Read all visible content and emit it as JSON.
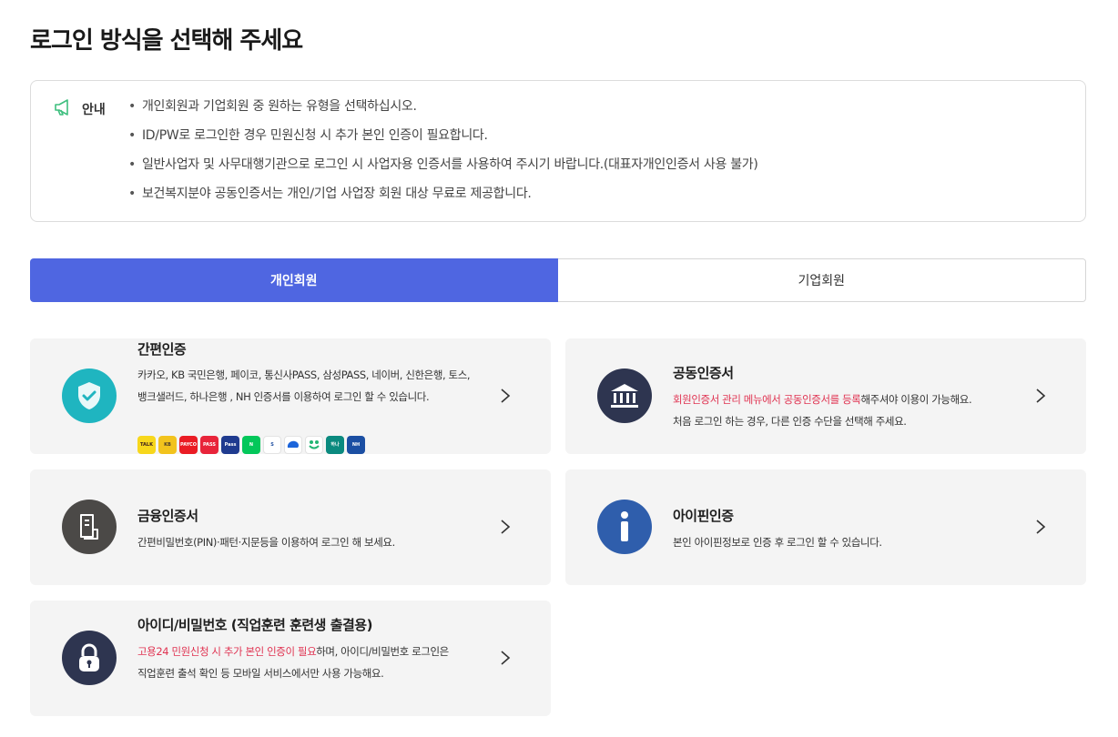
{
  "page": {
    "title": "로그인 방식을 선택해 주세요"
  },
  "notice": {
    "label": "안내",
    "items": [
      "개인회원과 기업회원 중 원하는 유형을 선택하십시오.",
      "ID/PW로 로그인한 경우 민원신청 시 추가 본인 인증이 필요합니다.",
      "일반사업자 및 사무대행기관으로 로그인 시 사업자용 인증서를 사용하여 주시기 바랍니다.(대표자개인인증서 사용 불가)",
      "보건복지분야 공동인증서는 개인/기업 사업장 회원 대상 무료로 제공합니다."
    ]
  },
  "tabs": [
    {
      "label": "개인회원",
      "active": true
    },
    {
      "label": "기업회원",
      "active": false
    }
  ],
  "methods": {
    "simple": {
      "title": "간편인증",
      "desc": "카카오, KB 국민은행, 페이코, 통신사PASS, 삼성PASS, 네이버, 신한은행, 토스, 뱅크샐러드, 하나은행 , NH 인증서를 이용하여 로그인 할 수 있습니다.",
      "brands": [
        {
          "icon": "kakao-icon",
          "text": "TALK",
          "bg": "#f7d71c",
          "fg": "#3b1e1e"
        },
        {
          "icon": "kb-icon",
          "text": "KB",
          "bg": "#f2c31d",
          "fg": "#4a3b2a"
        },
        {
          "icon": "payco-icon",
          "text": "PAYCO",
          "bg": "#ea1c24",
          "fg": "#ffffff"
        },
        {
          "icon": "pass-icon",
          "text": "PASS",
          "bg": "#e8243a",
          "fg": "#ffffff"
        },
        {
          "icon": "samsung-pass-icon",
          "text": "Pass",
          "bg": "#1f3b8f",
          "fg": "#ffffff"
        },
        {
          "icon": "naver-icon",
          "text": "N",
          "bg": "#03c75a",
          "fg": "#ffffff"
        },
        {
          "icon": "shinhan-icon",
          "text": "S",
          "bg": "#ffffff",
          "fg": "#1f4ea0"
        },
        {
          "icon": "toss-icon",
          "text": "",
          "bg": "#ffffff",
          "fg": "#1b64da"
        },
        {
          "icon": "banksalad-icon",
          "text": "",
          "bg": "#ffffff",
          "fg": "#22b573"
        },
        {
          "icon": "hana-icon",
          "text": "하나",
          "bg": "#0b8a7f",
          "fg": "#ffffff"
        },
        {
          "icon": "nh-icon",
          "text": "NH",
          "bg": "#1b4fa3",
          "fg": "#ffffff"
        }
      ]
    },
    "joint": {
      "title": "공동인증서",
      "desc_red": "회원인증서 관리 메뉴에서 공동인증서를 등록",
      "desc_rest": "해주셔야 이용이 가능해요.",
      "desc_line2": "처음 로그인 하는 경우, 다른 인증 수단을 선택해 주세요."
    },
    "finance": {
      "title": "금융인증서",
      "desc": "간편비밀번호(PIN)·패턴·지문등을 이용하여 로그인 해 보세요."
    },
    "ipin": {
      "title": "아이핀인증",
      "desc": "본인 아이핀정보로 인증 후 로그인 할 수 있습니다."
    },
    "idpw": {
      "title": "아이디/비밀번호 (직업훈련 훈련생 출결용)",
      "desc_red": "고용24 민원신청 시 추가 본인 인증이 필요",
      "desc_rest": "하며, 아이디/비밀번호 로그인은",
      "desc_line2": "직업훈련 출석 확인 등 모바일 서비스에서만 사용 가능해요."
    }
  },
  "colors": {
    "accent": "#4f66e1",
    "simple_icon_bg": "#1fb5c0",
    "joint_icon_bg": "#2e3550",
    "finance_icon_bg": "#4b4947",
    "ipin_icon_bg": "#2f5eac",
    "idpw_icon_bg": "#2e3550",
    "warning": "#e03452"
  }
}
